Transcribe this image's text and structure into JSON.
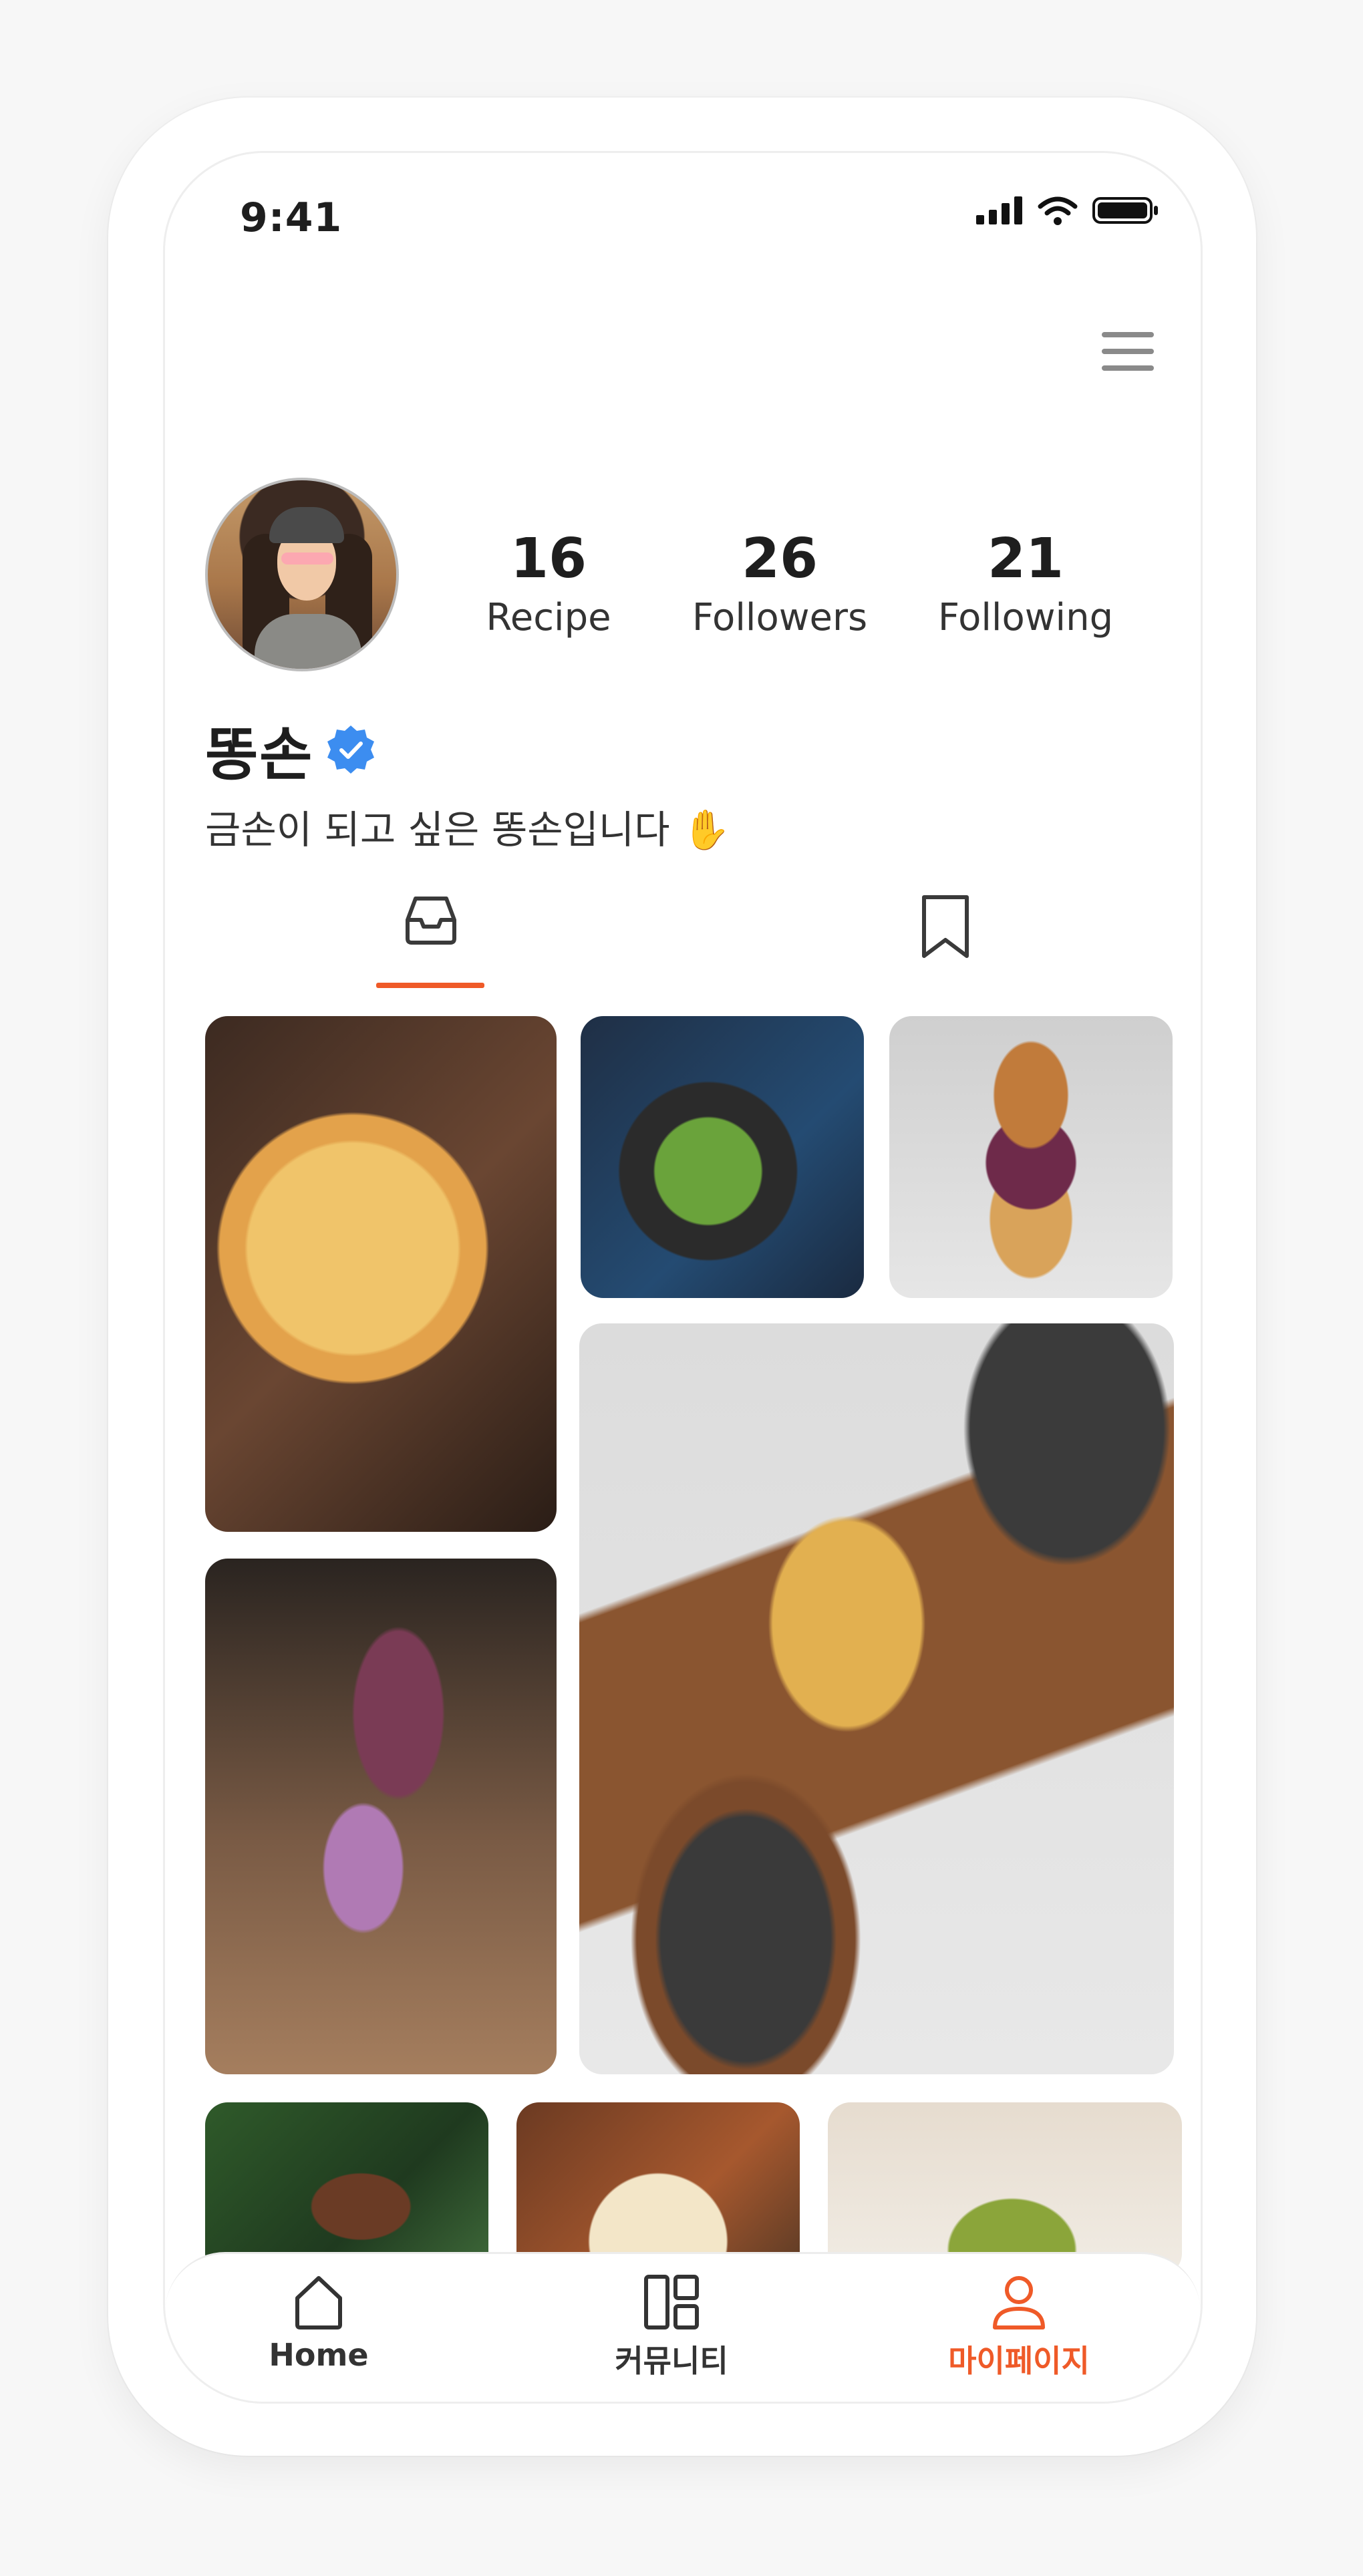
{
  "status_bar": {
    "time": "9:41"
  },
  "profile": {
    "stats": [
      {
        "value": "16",
        "label": "Recipe"
      },
      {
        "value": "26",
        "label": "Followers"
      },
      {
        "value": "21",
        "label": "Following"
      }
    ],
    "name": "똥손",
    "bio": "금손이 되고 싶은 똥손입니다 ✋"
  },
  "tabs": [
    {
      "icon": "inbox-icon",
      "active": true
    },
    {
      "icon": "bookmark-icon",
      "active": false
    }
  ],
  "bottom_nav": {
    "home_label": "Home",
    "community_label": "커뮤니티",
    "mypage_label": "마이페이지",
    "active": "mypage"
  },
  "colors": {
    "accent": "#ef5a28",
    "verified": "#3c8df0",
    "text": "#1e1e1e"
  }
}
